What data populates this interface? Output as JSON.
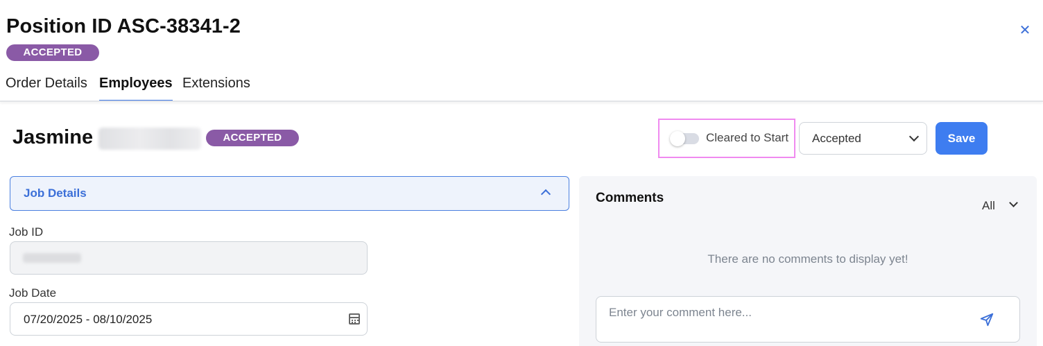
{
  "header": {
    "title": "Position ID ASC-38341-2",
    "status_badge": "ACCEPTED",
    "close_icon": "close-icon"
  },
  "tabs": [
    {
      "label": "Order Details",
      "active": false
    },
    {
      "label": "Employees",
      "active": true
    },
    {
      "label": "Extensions",
      "active": false
    }
  ],
  "employee": {
    "first_name": "Jasmine",
    "status_badge": "ACCEPTED",
    "cleared_to_start": {
      "label": "Cleared to Start",
      "enabled": false
    },
    "status_select": {
      "value": "Accepted"
    },
    "save_label": "Save"
  },
  "job_details": {
    "section_label": "Job Details",
    "job_id_label": "Job ID",
    "job_date_label": "Job Date",
    "job_date_value": "07/20/2025 - 08/10/2025"
  },
  "comments": {
    "title": "Comments",
    "filter_value": "All",
    "empty_message": "There are no comments to display yet!",
    "input_placeholder": "Enter your comment here..."
  },
  "colors": {
    "badge": "#8a5aa6",
    "accent": "#3e7df0",
    "highlight_box": "#f08af0"
  },
  "icons": [
    "close-icon",
    "chevron-down-icon",
    "chevron-up-icon",
    "calendar-icon",
    "send-icon"
  ]
}
